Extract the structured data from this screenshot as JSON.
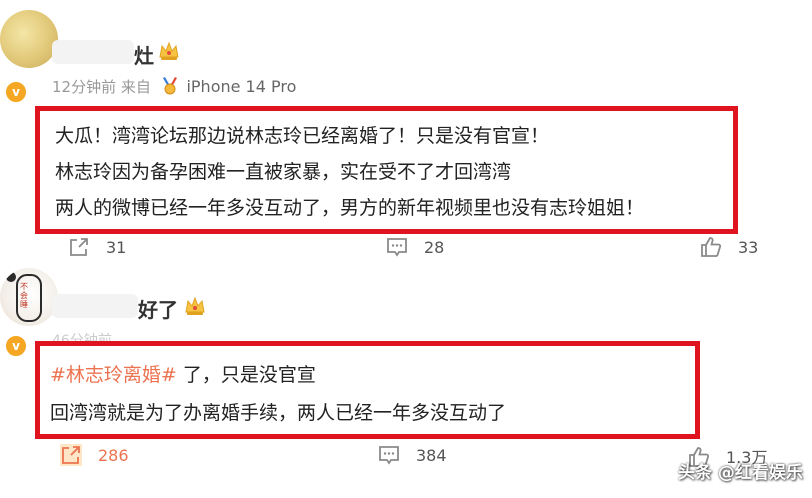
{
  "comments": [
    {
      "username_visible": "灶",
      "time": "12分钟前",
      "source_prefix": "来自",
      "device": "iPhone 14 Pro",
      "lines": [
        "大瓜！湾湾论坛那边说林志玲已经离婚了！只是没有官宣！",
        "林志玲因为备孕困难一直被家暴，实在受不了才回湾湾",
        "两人的微博已经一年多没互动了，男方的新年视频里也没有志玲姐姐！"
      ],
      "actions": {
        "share": "31",
        "comment": "28",
        "like": "33"
      }
    },
    {
      "username_visible": "好了",
      "time": "46分钟前",
      "hashtag": "#林志玲离婚#",
      "line1_rest": " 了，只是没官宣",
      "line2": "回湾湾就是为了办离婚手续，两人已经一年多没互动了",
      "actions": {
        "share": "286",
        "comment": "384",
        "like": "1.3万"
      }
    }
  ],
  "avatar2_doodle_text": "不会睡",
  "watermark": "头条 @红看娱乐",
  "colors": {
    "highlight_border": "#e0141e",
    "hashtag": "#eb7350",
    "badge": "#f5a623"
  },
  "icons": [
    "share-icon",
    "comment-icon",
    "like-icon",
    "crown-icon",
    "verified-badge-icon",
    "medal-icon"
  ]
}
